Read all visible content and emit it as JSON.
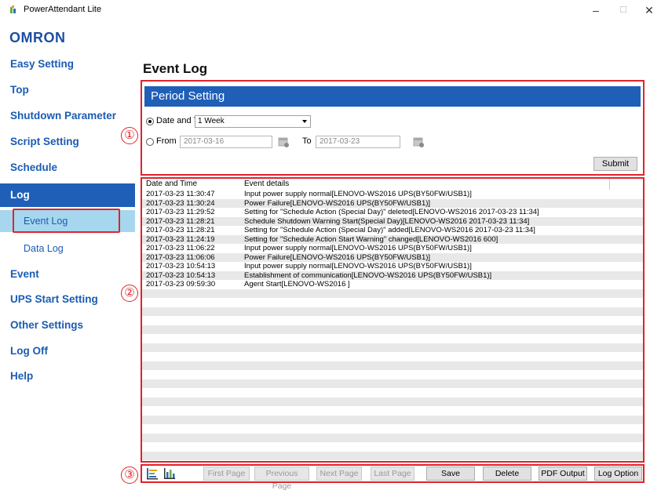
{
  "window": {
    "title": "PowerAttendant Lite",
    "minimize": "–",
    "maximize": "☐",
    "close": "✕"
  },
  "brand": "OMRON",
  "sidebar": {
    "items": [
      {
        "label": "Easy Setting"
      },
      {
        "label": "Top"
      },
      {
        "label": "Shutdown Parameter"
      },
      {
        "label": "Script Setting"
      },
      {
        "label": "Schedule"
      },
      {
        "label": "Log"
      },
      {
        "label": "Event Log"
      },
      {
        "label": "Data Log"
      },
      {
        "label": "Event"
      },
      {
        "label": "UPS Start Setting"
      },
      {
        "label": "Other Settings"
      },
      {
        "label": "Log Off"
      },
      {
        "label": "Help"
      }
    ]
  },
  "page_title": "Event Log",
  "annotations": {
    "one": "①",
    "two": "②",
    "three": "③"
  },
  "period": {
    "header": "Period Setting",
    "date_time_label": "Date and Time",
    "range_selected": "1 Week",
    "from_label": "From",
    "from_value": "2017-03-16",
    "to_label": "To",
    "to_value": "2017-03-23",
    "submit": "Submit"
  },
  "table": {
    "columns": [
      "Date and Time",
      "Event details"
    ],
    "rows": [
      {
        "time": "2017-03-23 11:30:47",
        "detail": "Input power supply normal[LENOVO-WS2016 UPS(BY50FW/USB1)]"
      },
      {
        "time": "2017-03-23 11:30:24",
        "detail": "Power Failure[LENOVO-WS2016 UPS(BY50FW/USB1)]"
      },
      {
        "time": "2017-03-23 11:29:52",
        "detail": "Setting for \"Schedule Action (Special Day)\" deleted[LENOVO-WS2016 2017-03-23 11:34]"
      },
      {
        "time": "2017-03-23 11:28:21",
        "detail": "Schedule Shutdown Warning Start(Special Day)[LENOVO-WS2016 2017-03-23 11:34]"
      },
      {
        "time": "2017-03-23 11:28:21",
        "detail": "Setting for \"Schedule Action (Special Day)\" added[LENOVO-WS2016 2017-03-23 11:34]"
      },
      {
        "time": "2017-03-23 11:24:19",
        "detail": "Setting for \"Schedule Action Start Warning\" changed[LENOVO-WS2016 600]"
      },
      {
        "time": "2017-03-23 11:06:22",
        "detail": "Input power supply normal[LENOVO-WS2016 UPS(BY50FW/USB1)]"
      },
      {
        "time": "2017-03-23 11:06:06",
        "detail": "Power Failure[LENOVO-WS2016 UPS(BY50FW/USB1)]"
      },
      {
        "time": "2017-03-23 10:54:13",
        "detail": "Input power supply normal[LENOVO-WS2016 UPS(BY50FW/USB1)]"
      },
      {
        "time": "2017-03-23 10:54:13",
        "detail": "Establishment of communication[LENOVO-WS2016 UPS(BY50FW/USB1)]"
      },
      {
        "time": "2017-03-23 09:59:30",
        "detail": "Agent Start[LENOVO-WS2016 ]"
      }
    ]
  },
  "toolbar": {
    "first_page": "First Page",
    "previous_page": "Previous Page",
    "next_page": "Next Page",
    "last_page": "Last Page",
    "save": "Save",
    "delete": "Delete",
    "pdf_output": "PDF Output",
    "log_option": "Log Option"
  },
  "colors": {
    "accent": "#1f5fb8",
    "highlight": "#e0232b",
    "selected_bg": "#a6d7ef"
  }
}
